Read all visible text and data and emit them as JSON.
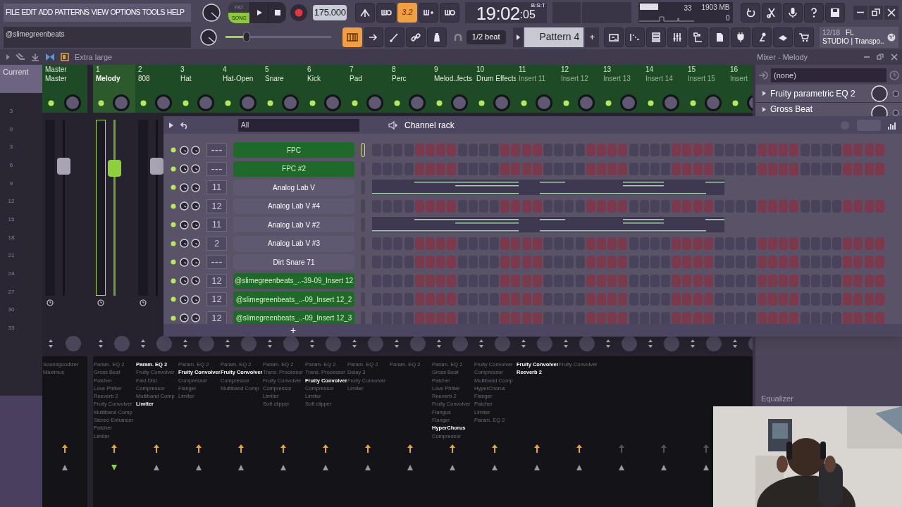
{
  "menu": [
    "FILE",
    "EDIT",
    "ADD",
    "PATTERNS",
    "VIEW",
    "OPTIONS",
    "TOOLS",
    "HELP"
  ],
  "transport": {
    "modes": [
      {
        "label": "PAT",
        "selected": false
      },
      {
        "label": "SONG",
        "selected": true
      }
    ],
    "tempo": "175.000"
  },
  "toggles_top": [
    {
      "on": false
    },
    {
      "on": false
    },
    {
      "label": "3.2",
      "on": true
    },
    {
      "on": false
    },
    {
      "on": false
    }
  ],
  "toggles_bottom": [
    {
      "on": true
    },
    {
      "on": false
    },
    {
      "on": false
    },
    {
      "on": false
    },
    {
      "on": false
    }
  ],
  "clock": {
    "main": "19:02",
    "sub": ":05",
    "format": "B:S:T"
  },
  "monitor": {
    "cpu": "33",
    "memory": "1903 MB",
    "polyphony": "0"
  },
  "hint": "@slimegreenbeats",
  "master_volume": {
    "level": 0.2
  },
  "snap": "1/2 beat",
  "pattern": {
    "name": "Pattern 4",
    "add": "+"
  },
  "news": {
    "count": "12/18",
    "line_1": "FL",
    "line_2": "STUDIO | Transpo.."
  },
  "browser": {
    "size": "Extra large"
  },
  "mixer": {
    "title": "Mixer - Melody",
    "current": "Current",
    "scale": [
      "3",
      "0",
      "3",
      "6",
      "9",
      "12",
      "15",
      "18",
      "21",
      "24",
      "27",
      "30",
      "33"
    ],
    "tracks": [
      {
        "number": "Master",
        "name": "Master",
        "selected": false,
        "renamed": true,
        "fader": {
          "level": 0.76
        },
        "effects": [
          {
            "name": "Soundgoodizer",
            "highlighted": false
          },
          {
            "name": "Maximus",
            "highlighted": false
          }
        ]
      },
      {
        "number": "1",
        "name": "Melody",
        "selected": true,
        "renamed": true,
        "fader": {
          "level": 0.75
        },
        "effects": [
          {
            "name": "Param. EQ 2",
            "highlighted": false
          },
          {
            "name": "Gross Beat",
            "highlighted": false
          },
          {
            "name": "Patcher",
            "highlighted": false
          },
          {
            "name": "Love Philter",
            "highlighted": false
          },
          {
            "name": "Reeverb 2",
            "highlighted": false
          },
          {
            "name": "Fruity Convolver",
            "highlighted": false
          },
          {
            "name": "Multiband Comp",
            "highlighted": false
          },
          {
            "name": "Stereo Enhancer",
            "highlighted": false
          },
          {
            "name": "Patcher",
            "highlighted": false
          },
          {
            "name": "Limiter",
            "highlighted": false
          }
        ]
      },
      {
        "number": "2",
        "name": "808",
        "selected": false,
        "renamed": true,
        "fader": {
          "level": 0.76
        },
        "effects": [
          {
            "name": "Param. EQ 2",
            "highlighted": true
          },
          {
            "name": "Fruity Convolver",
            "highlighted": false
          },
          {
            "name": "Fast Dist",
            "highlighted": false
          },
          {
            "name": "Compressor",
            "highlighted": false
          },
          {
            "name": "Multiband Comp",
            "highlighted": false
          },
          {
            "name": "Limiter",
            "highlighted": true
          }
        ]
      },
      {
        "number": "3",
        "name": "Hat",
        "selected": false,
        "renamed": true,
        "effects": [
          {
            "name": "Param. EQ 2",
            "highlighted": false
          },
          {
            "name": "Fruity Convolver",
            "highlighted": true
          },
          {
            "name": "Compressor",
            "highlighted": false
          },
          {
            "name": "Flanger",
            "highlighted": false
          },
          {
            "name": "Limiter",
            "highlighted": false
          }
        ]
      },
      {
        "number": "4",
        "name": "Hat-Open",
        "selected": false,
        "renamed": true,
        "effects": [
          {
            "name": "Param. EQ 2",
            "highlighted": false
          },
          {
            "name": "Fruity Convolver",
            "highlighted": true
          },
          {
            "name": "Compressor",
            "highlighted": false
          },
          {
            "name": "Multiband Comp",
            "highlighted": false
          }
        ]
      },
      {
        "number": "5",
        "name": "Snare",
        "selected": false,
        "renamed": true,
        "effects": [
          {
            "name": "Param. EQ 2",
            "highlighted": false
          },
          {
            "name": "Trans. Processor",
            "highlighted": false
          },
          {
            "name": "Fruity Convolver",
            "highlighted": false
          },
          {
            "name": "Compressor",
            "highlighted": false
          },
          {
            "name": "Limiter",
            "highlighted": false
          },
          {
            "name": "Soft clipper",
            "highlighted": false
          }
        ]
      },
      {
        "number": "6",
        "name": "Kick",
        "selected": false,
        "renamed": true,
        "effects": [
          {
            "name": "Param. EQ 2",
            "highlighted": false
          },
          {
            "name": "Trans. Processor",
            "highlighted": false
          },
          {
            "name": "Fruity Convolver",
            "highlighted": true
          },
          {
            "name": "Compressor",
            "highlighted": false
          },
          {
            "name": "Limiter",
            "highlighted": false
          },
          {
            "name": "Soft clipper",
            "highlighted": false
          }
        ]
      },
      {
        "number": "7",
        "name": "Pad",
        "selected": false,
        "renamed": true,
        "effects": [
          {
            "name": "Param. EQ 2",
            "highlighted": false
          },
          {
            "name": "Delay 3",
            "highlighted": false
          },
          {
            "name": "Fruity Convolver",
            "highlighted": false
          },
          {
            "name": "Limiter",
            "highlighted": false
          }
        ]
      },
      {
        "number": "8",
        "name": "Perc",
        "selected": false,
        "renamed": true,
        "effects": [
          {
            "name": "Param. EQ 2",
            "highlighted": false
          }
        ]
      },
      {
        "number": "9",
        "name": "Melod..fects",
        "selected": false,
        "renamed": true,
        "effects": [
          {
            "name": "Param. EQ 2",
            "highlighted": false
          },
          {
            "name": "Gross Beat",
            "highlighted": false
          },
          {
            "name": "Patcher",
            "highlighted": false
          },
          {
            "name": "Love Philter",
            "highlighted": false
          },
          {
            "name": "Reeverb 2",
            "highlighted": false
          },
          {
            "name": "Fruity Convolver",
            "highlighted": false
          },
          {
            "name": "Flangus",
            "highlighted": false
          },
          {
            "name": "Flanger",
            "highlighted": false
          },
          {
            "name": "HyperChorus",
            "highlighted": true
          },
          {
            "name": "Compressor",
            "highlighted": false
          }
        ]
      },
      {
        "number": "10",
        "name": "Drum Effects",
        "selected": false,
        "renamed": true,
        "effects": [
          {
            "name": "Fruity Convolver",
            "highlighted": false
          },
          {
            "name": "Compressor",
            "highlighted": false
          },
          {
            "name": "Multiband Comp",
            "highlighted": false
          },
          {
            "name": "HyperChorus",
            "highlighted": false
          },
          {
            "name": "Flanger",
            "highlighted": false
          },
          {
            "name": "Patcher",
            "highlighted": false
          },
          {
            "name": "Limiter",
            "highlighted": false
          },
          {
            "name": "Param. EQ 2",
            "highlighted": false
          }
        ]
      },
      {
        "number": "11",
        "name": "Insert 11",
        "selected": false,
        "renamed": false,
        "effects": [
          {
            "name": "Fruity Convolver",
            "highlighted": true
          },
          {
            "name": "Reeverb 2",
            "highlighted": true
          }
        ]
      },
      {
        "number": "12",
        "name": "Insert 12",
        "selected": false,
        "renamed": false,
        "effects": [
          {
            "name": "Fruity Convolver",
            "highlighted": false
          }
        ]
      },
      {
        "number": "13",
        "name": "Insert 13",
        "selected": false,
        "renamed": false
      },
      {
        "number": "14",
        "name": "Insert 14",
        "selected": false,
        "renamed": false
      },
      {
        "number": "15",
        "name": "Insert 15",
        "selected": false,
        "renamed": false
      },
      {
        "number": "16",
        "name": "Insert",
        "selected": false,
        "renamed": false
      }
    ]
  },
  "insert_panel": {
    "input": "(none)",
    "slots": [
      "Fruity parametric EQ 2",
      "Gross Beat"
    ],
    "section": "Equalizer"
  },
  "channel_rack": {
    "title": "Channel rack",
    "filter": "All",
    "add": "+",
    "channels": [
      {
        "number": "---",
        "name": "FPC",
        "selected": true,
        "kind": "steps"
      },
      {
        "number": "---",
        "name": "FPC #2",
        "selected": true,
        "kind": "steps"
      },
      {
        "number": "11",
        "name": "Analog Lab V",
        "selected": false,
        "kind": "notes"
      },
      {
        "number": "12",
        "name": "Analog Lab V #4",
        "selected": false,
        "kind": "steps"
      },
      {
        "number": "11",
        "name": "Analog Lab V #2",
        "selected": false,
        "kind": "notes"
      },
      {
        "number": "2",
        "name": "Analog Lab V #3",
        "selected": false,
        "kind": "steps"
      },
      {
        "number": "---",
        "name": "Dirt Snare 71",
        "selected": false,
        "kind": "steps"
      },
      {
        "number": "12",
        "name": "@slimegreenbeats_..-39-09_Insert 12",
        "selected": true,
        "kind": "steps"
      },
      {
        "number": "12",
        "name": "@slimegreenbeats_..-09_Insert 12_2",
        "selected": true,
        "kind": "steps"
      },
      {
        "number": "12",
        "name": "@slimegreenbeats_..-09_Insert 12_3",
        "selected": true,
        "kind": "steps"
      }
    ]
  }
}
